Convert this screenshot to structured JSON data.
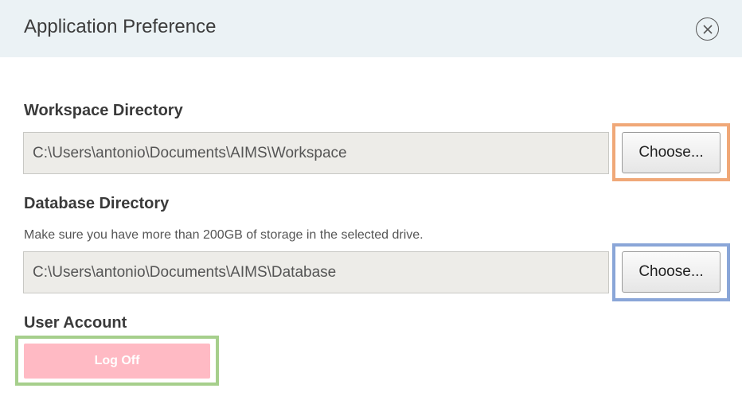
{
  "dialog": {
    "title": "Application Preference",
    "close_icon": "close-circle-icon"
  },
  "workspace": {
    "label": "Workspace Directory",
    "path": "C:\\Users\\antonio\\Documents\\AIMS\\Workspace",
    "choose_label": "Choose..."
  },
  "database": {
    "label": "Database Directory",
    "hint": "Make sure you have more than 200GB of storage in the selected drive.",
    "path": "C:\\Users\\antonio\\Documents\\AIMS\\Database",
    "choose_label": "Choose..."
  },
  "account": {
    "label": "User Account",
    "logoff_label": "Log Off"
  },
  "colors": {
    "header_bg": "#ebf2f5",
    "workspace_highlight": "#f0a878",
    "database_highlight": "#8aa6d8",
    "logoff_highlight": "#a6cf8c",
    "logoff_bg": "#ffbac4"
  }
}
